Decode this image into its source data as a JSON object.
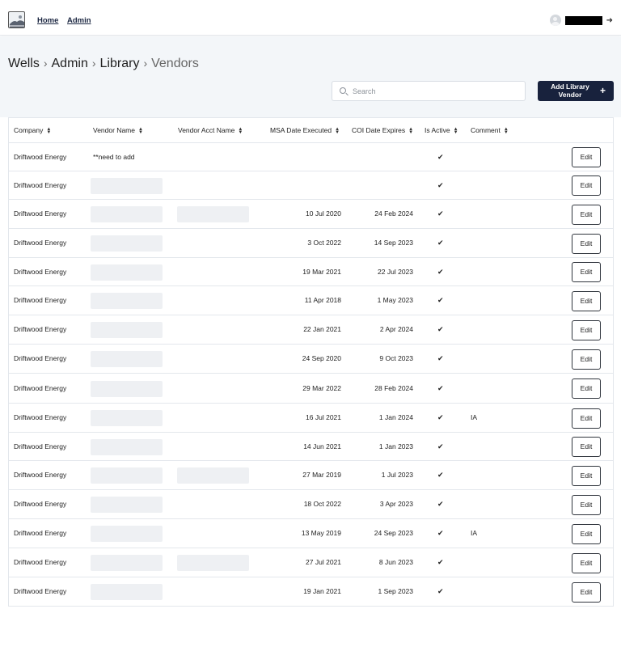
{
  "nav": {
    "home": "Home",
    "admin": "Admin"
  },
  "breadcrumb": {
    "items": [
      "Wells",
      "Admin",
      "Library",
      "Vendors"
    ]
  },
  "search": {
    "placeholder": "Search",
    "value": ""
  },
  "add_button": {
    "label": "Add Library Vendor",
    "icon": "plus-icon"
  },
  "table": {
    "columns": [
      "Company",
      "Vendor Name",
      "Vendor Acct Name",
      "MSA Date Executed",
      "COI Date Expires",
      "Is Active",
      "Comment"
    ],
    "edit_label": "Edit",
    "rows": [
      {
        "company": "Driftwood Energy",
        "vendor_name": "**need to add",
        "vendor_redacted": false,
        "acct_redacted": false,
        "msa": "",
        "coi": "",
        "active": true,
        "comment": ""
      },
      {
        "company": "Driftwood Energy",
        "vendor_name": "",
        "vendor_redacted": true,
        "acct_redacted": false,
        "msa": "",
        "coi": "",
        "active": true,
        "comment": ""
      },
      {
        "company": "Driftwood Energy",
        "vendor_name": "",
        "vendor_redacted": true,
        "acct_redacted": true,
        "msa": "10 Jul 2020",
        "coi": "24 Feb 2024",
        "active": true,
        "comment": ""
      },
      {
        "company": "Driftwood Energy",
        "vendor_name": "",
        "vendor_redacted": true,
        "acct_redacted": false,
        "msa": "3 Oct 2022",
        "coi": "14 Sep 2023",
        "active": true,
        "comment": ""
      },
      {
        "company": "Driftwood Energy",
        "vendor_name": "",
        "vendor_redacted": true,
        "acct_redacted": false,
        "msa": "19 Mar 2021",
        "coi": "22 Jul 2023",
        "active": true,
        "comment": ""
      },
      {
        "company": "Driftwood Energy",
        "vendor_name": "",
        "vendor_redacted": true,
        "acct_redacted": false,
        "msa": "11 Apr 2018",
        "coi": "1 May 2023",
        "active": true,
        "comment": ""
      },
      {
        "company": "Driftwood Energy",
        "vendor_name": "",
        "vendor_redacted": true,
        "acct_redacted": false,
        "msa": "22 Jan 2021",
        "coi": "2 Apr 2024",
        "active": true,
        "comment": ""
      },
      {
        "company": "Driftwood Energy",
        "vendor_name": "",
        "vendor_redacted": true,
        "acct_redacted": false,
        "msa": "24 Sep 2020",
        "coi": "9 Oct 2023",
        "active": true,
        "comment": ""
      },
      {
        "company": "Driftwood Energy",
        "vendor_name": "",
        "vendor_redacted": true,
        "acct_redacted": false,
        "msa": "29 Mar 2022",
        "coi": "28 Feb 2024",
        "active": true,
        "comment": ""
      },
      {
        "company": "Driftwood Energy",
        "vendor_name": "",
        "vendor_redacted": true,
        "acct_redacted": false,
        "msa": "16 Jul 2021",
        "coi": "1 Jan 2024",
        "active": true,
        "comment": "IA"
      },
      {
        "company": "Driftwood Energy",
        "vendor_name": "",
        "vendor_redacted": true,
        "acct_redacted": false,
        "msa": "14 Jun 2021",
        "coi": "1 Jan 2023",
        "active": true,
        "comment": ""
      },
      {
        "company": "Driftwood Energy",
        "vendor_name": "",
        "vendor_redacted": true,
        "acct_redacted": true,
        "msa": "27 Mar 2019",
        "coi": "1 Jul 2023",
        "active": true,
        "comment": ""
      },
      {
        "company": "Driftwood Energy",
        "vendor_name": "",
        "vendor_redacted": true,
        "acct_redacted": false,
        "msa": "18 Oct 2022",
        "coi": "3 Apr 2023",
        "active": true,
        "comment": ""
      },
      {
        "company": "Driftwood Energy",
        "vendor_name": "",
        "vendor_redacted": true,
        "acct_redacted": false,
        "msa": "13 May 2019",
        "coi": "24 Sep 2023",
        "active": true,
        "comment": "IA"
      },
      {
        "company": "Driftwood Energy",
        "vendor_name": "",
        "vendor_redacted": true,
        "acct_redacted": true,
        "msa": "27 Jul 2021",
        "coi": "8 Jun 2023",
        "active": true,
        "comment": ""
      },
      {
        "company": "Driftwood Energy",
        "vendor_name": "",
        "vendor_redacted": true,
        "acct_redacted": false,
        "msa": "19 Jan 2021",
        "coi": "1 Sep 2023",
        "active": true,
        "comment": ""
      }
    ]
  }
}
